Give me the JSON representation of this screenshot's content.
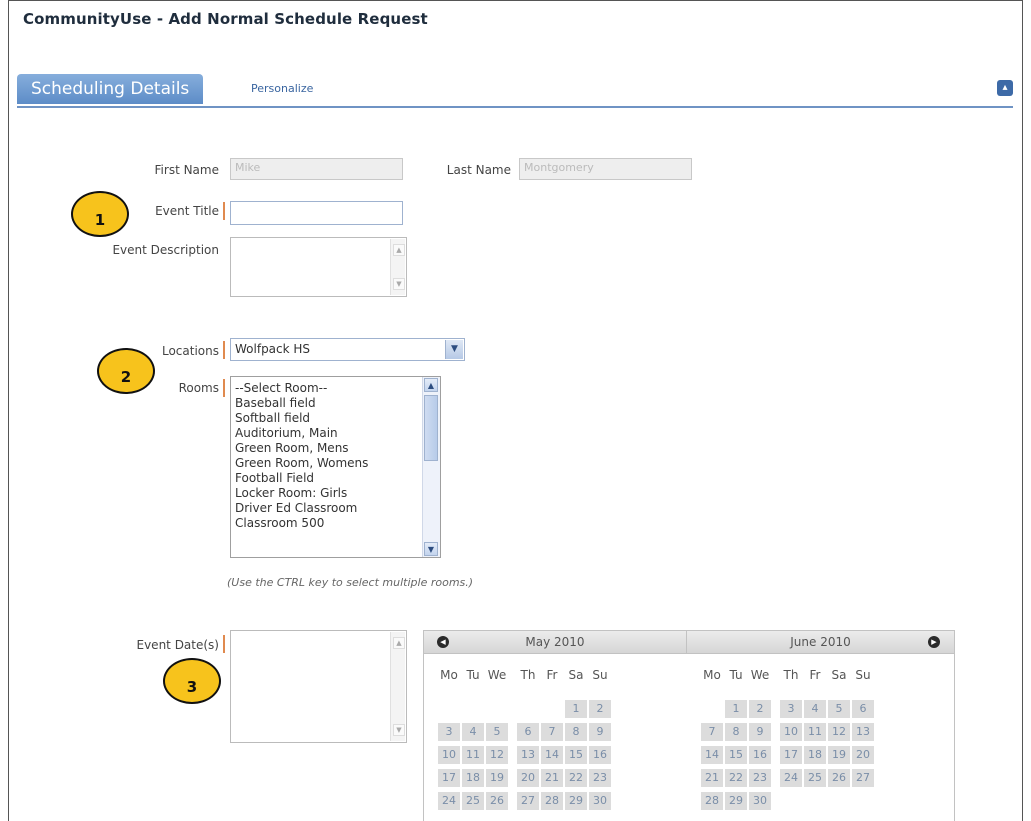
{
  "window": {
    "title": "CommunityUse - Add Normal Schedule Request"
  },
  "tabs": {
    "active_label": "Scheduling Details",
    "personalize_label": "Personalize",
    "collapse_symbol": "▴"
  },
  "form": {
    "first_name_label": "First Name",
    "first_name_value": "Mike",
    "last_name_label": "Last Name",
    "last_name_value": "Montgomery",
    "event_title_label": "Event Title",
    "event_title_value": "",
    "event_description_label": "Event Description",
    "locations_label": "Locations",
    "locations_value": "Wolfpack HS",
    "rooms_label": "Rooms",
    "rooms_options": [
      "--Select Room--",
      "Baseball field",
      "Softball field",
      "Auditorium, Main",
      "Green Room, Mens",
      "Green Room, Womens",
      "Football Field",
      "Locker Room: Girls",
      "Driver Ed Classroom",
      "Classroom 500"
    ],
    "rooms_hint": "(Use the CTRL key to select multiple rooms.)",
    "event_dates_label": "Event Date(s)"
  },
  "callouts": [
    "1",
    "2",
    "3"
  ],
  "calendar": {
    "months": [
      {
        "title": "May 2010"
      },
      {
        "title": "June 2010"
      }
    ],
    "weekdays": [
      "Mo",
      "Tu",
      "We",
      "Th",
      "Fr",
      "Sa",
      "Su"
    ],
    "may_weeks": [
      [
        "",
        "",
        "",
        "",
        "",
        "1",
        "2"
      ],
      [
        "3",
        "4",
        "5",
        "6",
        "7",
        "8",
        "9"
      ],
      [
        "10",
        "11",
        "12",
        "13",
        "14",
        "15",
        "16"
      ],
      [
        "17",
        "18",
        "19",
        "20",
        "21",
        "22",
        "23"
      ],
      [
        "24",
        "25",
        "26",
        "27",
        "28",
        "29",
        "30"
      ]
    ],
    "june_weeks": [
      [
        "",
        "1",
        "2",
        "3",
        "4",
        "5",
        "6"
      ],
      [
        "7",
        "8",
        "9",
        "10",
        "11",
        "12",
        "13"
      ],
      [
        "14",
        "15",
        "16",
        "17",
        "18",
        "19",
        "20"
      ],
      [
        "21",
        "22",
        "23",
        "24",
        "25",
        "26",
        "27"
      ],
      [
        "28",
        "29",
        "30",
        "",
        "",
        "",
        ""
      ]
    ]
  }
}
